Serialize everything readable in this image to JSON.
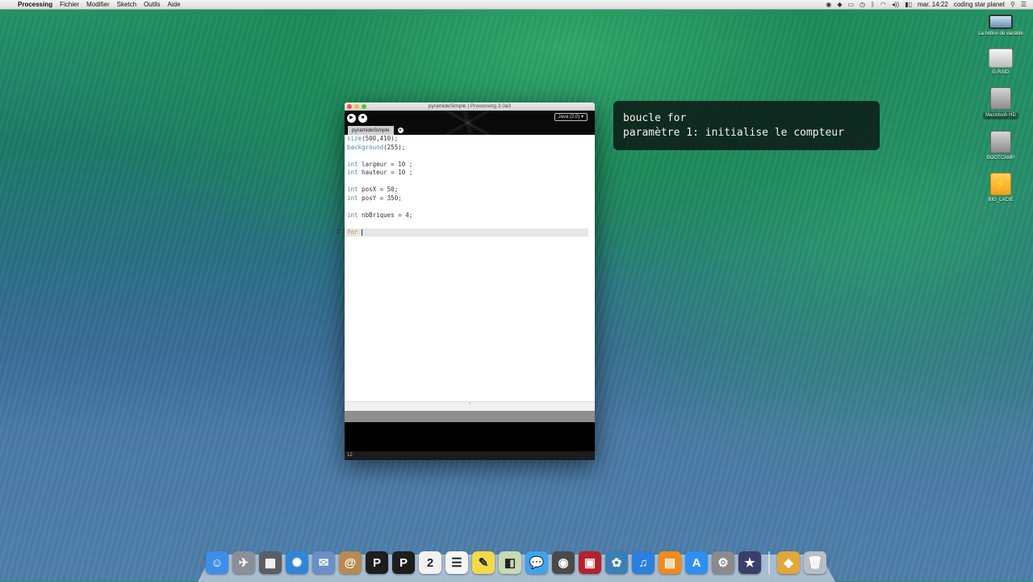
{
  "menubar": {
    "app_name": "Processing",
    "items": [
      "Fichier",
      "Modifier",
      "Sketch",
      "Outils",
      "Aide"
    ],
    "clock": "mar. 14:22",
    "user": "coding star planet"
  },
  "desktop_icons": [
    {
      "label": "La notion de variable",
      "icon": "monitor-icon"
    },
    {
      "label": "G-RAID",
      "icon": "external-drive-icon"
    },
    {
      "label": "Macintosh HD",
      "icon": "hard-disk-icon"
    },
    {
      "label": "BOOTCAMP",
      "icon": "hard-disk-icon"
    },
    {
      "label": "BIG_LACIE",
      "icon": "usb-drive-icon"
    }
  ],
  "note": {
    "line1": "boucle for",
    "line2": "paramètre 1: initialise le compteur"
  },
  "window": {
    "title": "pyramideSimple | Processing 3.0a3",
    "mode": "Java (2.0) ▾",
    "tab": "pyramideSimple",
    "line_number": "12",
    "code": [
      {
        "fn": "size",
        "rest": "(500,410);"
      },
      {
        "fn": "background",
        "rest": "(255);"
      },
      {
        "blank": true
      },
      {
        "kw": "int",
        "rest": " largeur = 10 ;"
      },
      {
        "kw": "int",
        "rest": " hauteur = 10 ;"
      },
      {
        "blank": true
      },
      {
        "kw": "int",
        "rest": " posX = 50;"
      },
      {
        "kw": "int",
        "rest": " posY = 350;"
      },
      {
        "blank": true
      },
      {
        "kw": "int",
        "rest": " nbBriques = 4;"
      },
      {
        "blank": true
      },
      {
        "kw2": "for",
        "rest": " ",
        "current": true
      }
    ]
  },
  "dock": {
    "apps": [
      {
        "name": "Finder",
        "icon": "finder-icon",
        "color": "#3d8ee8",
        "glyph": "☺"
      },
      {
        "name": "Launchpad",
        "icon": "rocket-icon",
        "color": "#8a8f98",
        "glyph": "✈"
      },
      {
        "name": "Mission Control",
        "icon": "mission-control-icon",
        "color": "#5a5f66",
        "glyph": "▦"
      },
      {
        "name": "Safari",
        "icon": "compass-icon",
        "color": "#2f86d9",
        "glyph": "✺"
      },
      {
        "name": "Mail",
        "icon": "stamp-icon",
        "color": "#6a8fc7",
        "glyph": "✉"
      },
      {
        "name": "Contacts",
        "icon": "address-book-icon",
        "color": "#b88a52",
        "glyph": "@"
      },
      {
        "name": "Processing 2",
        "icon": "processing-icon",
        "color": "#1d1d1d",
        "glyph": "P"
      },
      {
        "name": "Processing 3",
        "icon": "processing-icon",
        "color": "#1d1d1d",
        "glyph": "P"
      },
      {
        "name": "Calendar",
        "icon": "calendar-icon",
        "color": "#f2f2f2",
        "glyph": "2"
      },
      {
        "name": "Reminders",
        "icon": "list-icon",
        "color": "#f5f5f5",
        "glyph": "☰"
      },
      {
        "name": "Notes",
        "icon": "notes-icon",
        "color": "#f1d94a",
        "glyph": "✎"
      },
      {
        "name": "Preview",
        "icon": "preview-icon",
        "color": "#c9d9b4",
        "glyph": "◧"
      },
      {
        "name": "Messages",
        "icon": "chat-bubble-icon",
        "color": "#3ea4f0",
        "glyph": "💬"
      },
      {
        "name": "FaceTime",
        "icon": "camera-icon",
        "color": "#4a4a4a",
        "glyph": "◉"
      },
      {
        "name": "Photo Booth",
        "icon": "photo-booth-icon",
        "color": "#b5212a",
        "glyph": "▣"
      },
      {
        "name": "iPhoto",
        "icon": "palm-tree-icon",
        "color": "#3a7fb5",
        "glyph": "✿"
      },
      {
        "name": "iTunes",
        "icon": "music-note-icon",
        "color": "#2b7fdd",
        "glyph": "♫"
      },
      {
        "name": "iBooks",
        "icon": "book-icon",
        "color": "#f08b1e",
        "glyph": "▤"
      },
      {
        "name": "App Store",
        "icon": "app-store-icon",
        "color": "#2f8ff0",
        "glyph": "A"
      },
      {
        "name": "System Preferences",
        "icon": "gear-icon",
        "color": "#8a8a8a",
        "glyph": "⚙"
      },
      {
        "name": "iMovie",
        "icon": "clapperboard-icon",
        "color": "#3a3f6a",
        "glyph": "★"
      }
    ],
    "stack": {
      "name": "Applications",
      "icon": "folder-stack-icon",
      "color": "#e3a63a",
      "glyph": "◆"
    },
    "trash": {
      "name": "Trash",
      "icon": "trash-icon",
      "color": "#b9bec4",
      "glyph": "🗑"
    }
  }
}
